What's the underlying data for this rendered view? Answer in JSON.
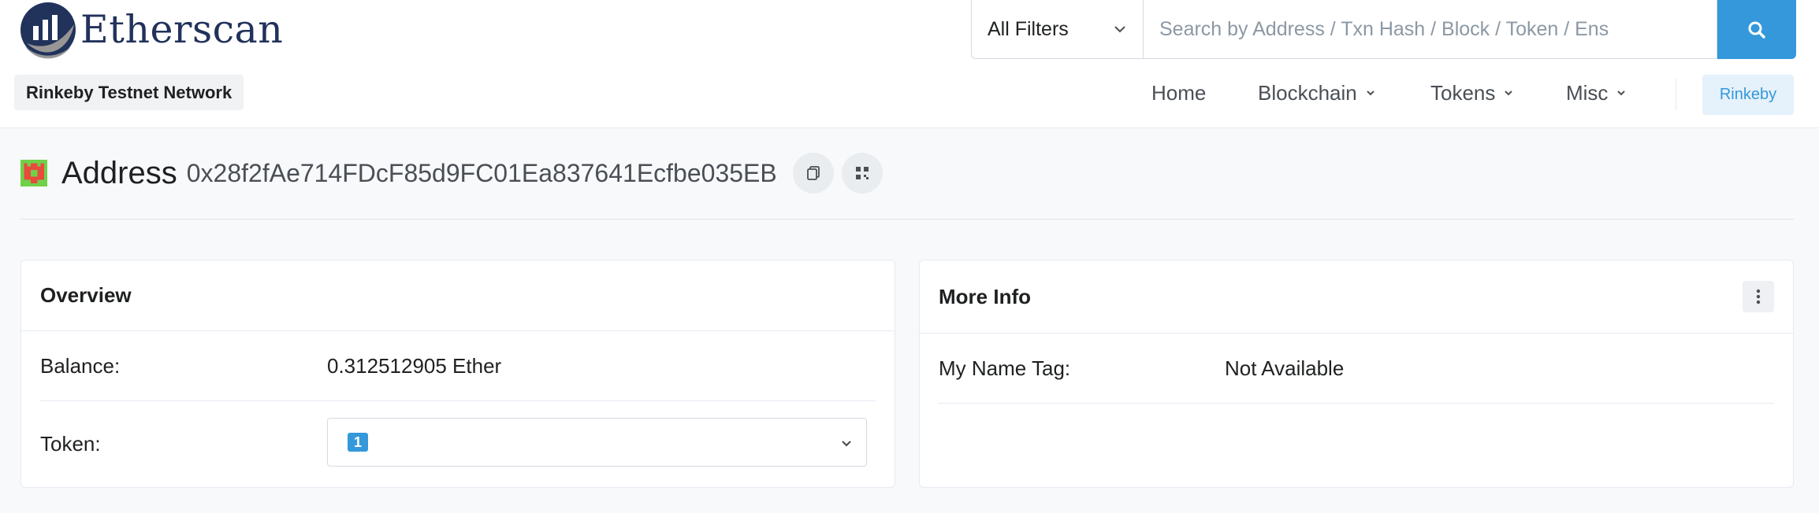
{
  "header": {
    "logo_text": "Etherscan",
    "network_badge": "Rinkeby Testnet Network",
    "search": {
      "filter_label": "All Filters",
      "placeholder": "Search by Address / Txn Hash / Block / Token / Ens"
    },
    "nav": [
      {
        "label": "Home"
      },
      {
        "label": "Blockchain"
      },
      {
        "label": "Tokens"
      },
      {
        "label": "Misc"
      }
    ],
    "network_button": "Rinkeby"
  },
  "address": {
    "label": "Address",
    "hash": "0x28f2fAe714FDcF85d9FC01Ea837641Ecfbe035EB"
  },
  "overview": {
    "title": "Overview",
    "balance_label": "Balance:",
    "balance_value": "0.312512905 Ether",
    "token_label": "Token:",
    "token_count": "1"
  },
  "more_info": {
    "title": "More Info",
    "name_tag_label": "My Name Tag:",
    "name_tag_value": "Not Available"
  },
  "colors": {
    "accent": "#3498db",
    "brand_dark": "#21325b"
  }
}
